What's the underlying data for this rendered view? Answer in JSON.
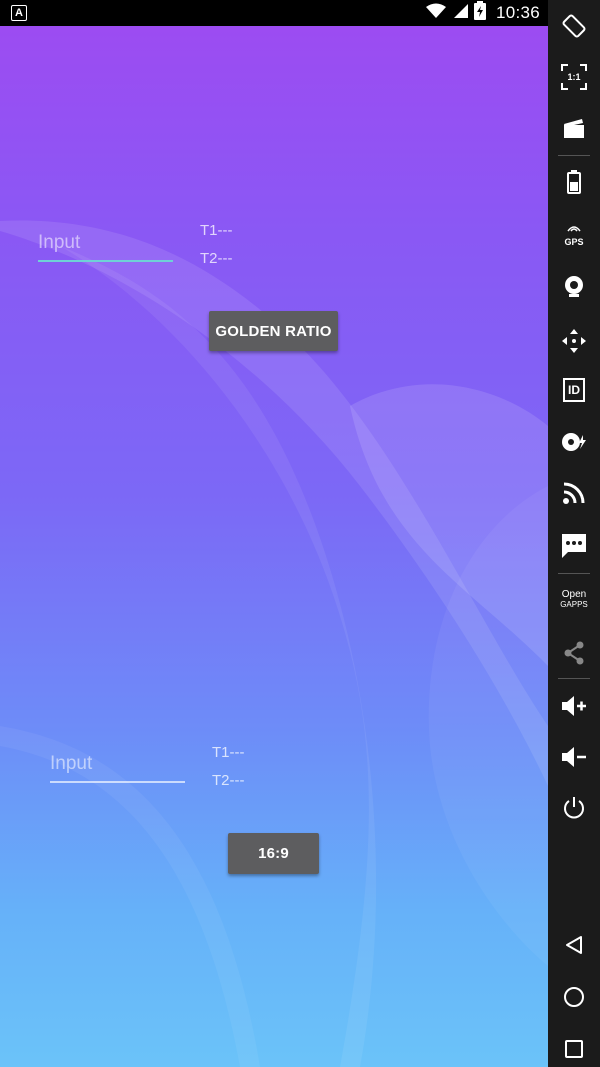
{
  "status_bar": {
    "app_badge": "A",
    "time": "10:36",
    "icons": [
      "wifi-icon",
      "signal-icon",
      "battery-charging-icon"
    ]
  },
  "app": {
    "section_golden": {
      "input_placeholder": "Input",
      "t1_label": "T1---",
      "t2_label": "T2---",
      "button_label": "GOLDEN RATIO"
    },
    "section_169": {
      "input_placeholder": "Input",
      "t1_label": "T1---",
      "t2_label": "T2---",
      "button_label": "16:9"
    }
  },
  "toolbar": {
    "one_to_one": "1:1",
    "gps": "GPS",
    "id": "ID",
    "open_gapps_line1": "Open",
    "open_gapps_line2": "GAPPS"
  },
  "colors": {
    "accent_underline": "#6fd1d6",
    "button_bg": "#5d5d5f",
    "gradient_top": "#9c4cf2",
    "gradient_bottom": "#6bc3f9",
    "toolbar_bg": "#1b1b1b"
  }
}
